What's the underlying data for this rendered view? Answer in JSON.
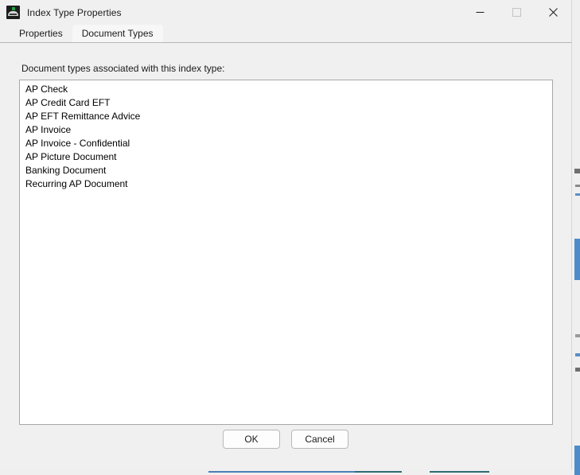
{
  "window": {
    "title": "Index Type Properties",
    "icon": "app-dome-icon",
    "controls": {
      "minimize": "minimize",
      "maximize": "maximize",
      "close": "close"
    }
  },
  "tabs": [
    {
      "label": "Properties",
      "selected": false
    },
    {
      "label": "Document Types",
      "selected": true
    }
  ],
  "panel": {
    "label": "Document types associated with this index type:",
    "items": [
      "AP Check",
      "AP Credit Card EFT",
      "AP EFT Remittance Advice",
      "AP Invoice",
      "AP Invoice - Confidential",
      "AP Picture Document",
      "Banking Document",
      "Recurring AP Document"
    ]
  },
  "footer": {
    "ok_label": "OK",
    "cancel_label": "Cancel"
  },
  "colors": {
    "window_bg": "#f0f0f0",
    "panel_bg": "#f0f0f0",
    "list_bg": "#ffffff",
    "list_border": "#a7a7a7",
    "tab_selected_bg": "#f7f7f7",
    "text": "#1b1b1b",
    "accent_green": "#21a244"
  }
}
